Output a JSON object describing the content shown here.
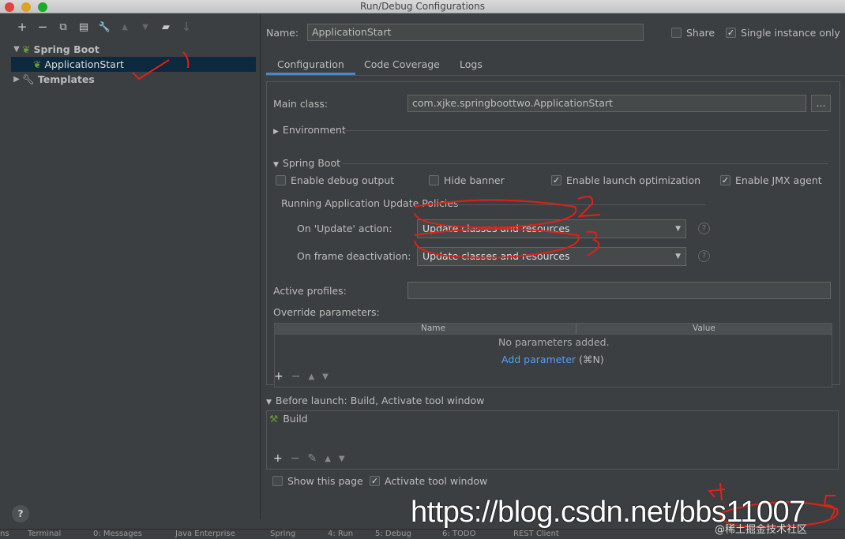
{
  "window": {
    "title": "Run/Debug Configurations"
  },
  "left": {
    "toolbar": [
      "+",
      "−",
      "⧉",
      "💾",
      "🔧",
      "▲",
      "▼",
      "📁",
      "↓"
    ],
    "tree": [
      {
        "label": "Spring Boot",
        "icon": "spring-boot-icon",
        "level": 0,
        "expanded": true
      },
      {
        "label": "ApplicationStart",
        "icon": "spring-run-icon",
        "level": 1,
        "selected": true
      },
      {
        "label": "Templates",
        "icon": "wrench-icon",
        "level": 0,
        "expanded": false
      }
    ],
    "help": "?"
  },
  "header": {
    "name_label": "Name:",
    "name_value": "ApplicationStart",
    "share_label": "Share",
    "single_instance_label": "Single instance only"
  },
  "tabs": [
    "Configuration",
    "Code Coverage",
    "Logs"
  ],
  "config": {
    "main_class_label": "Main class:",
    "main_class_value": "com.xjke.springboottwo.ApplicationStart",
    "browse": "...",
    "environment": "Environment",
    "spring_boot": "Spring Boot",
    "enable_debug": "Enable debug output",
    "hide_banner": "Hide banner",
    "enable_launch_opt": "Enable launch optimization",
    "enable_jmx": "Enable JMX agent",
    "update_policies": "Running Application Update Policies",
    "on_update_label": "On 'Update' action:",
    "on_update_value": "Update classes and resources",
    "on_frame_label": "On frame deactivation:",
    "on_frame_value": "Update classes and resources",
    "active_profiles_label": "Active profiles:",
    "override_label": "Override parameters:",
    "col_name": "Name",
    "col_value": "Value",
    "no_params": "No parameters added.",
    "add_param": "Add parameter",
    "add_param_shortcut": "(⌘N)"
  },
  "before_launch": {
    "title": "Before launch: Build, Activate tool window",
    "item": "Build",
    "show_page": "Show this page",
    "activate_tool": "Activate tool window"
  },
  "statusbar": [
    "ns",
    "Terminal",
    "0: Messages",
    "Java Enterprise",
    "Spring",
    "4: Run",
    "5: Debug",
    "6: TODO",
    "REST Client"
  ],
  "watermark": "https://blog.csdn.net/bbs11007",
  "watermark2": "@稀土掘金技术社区",
  "colors": {
    "accent": "#4a88c7",
    "selection": "#0d293e",
    "link": "#589df6",
    "annotation": "#e0201a"
  }
}
